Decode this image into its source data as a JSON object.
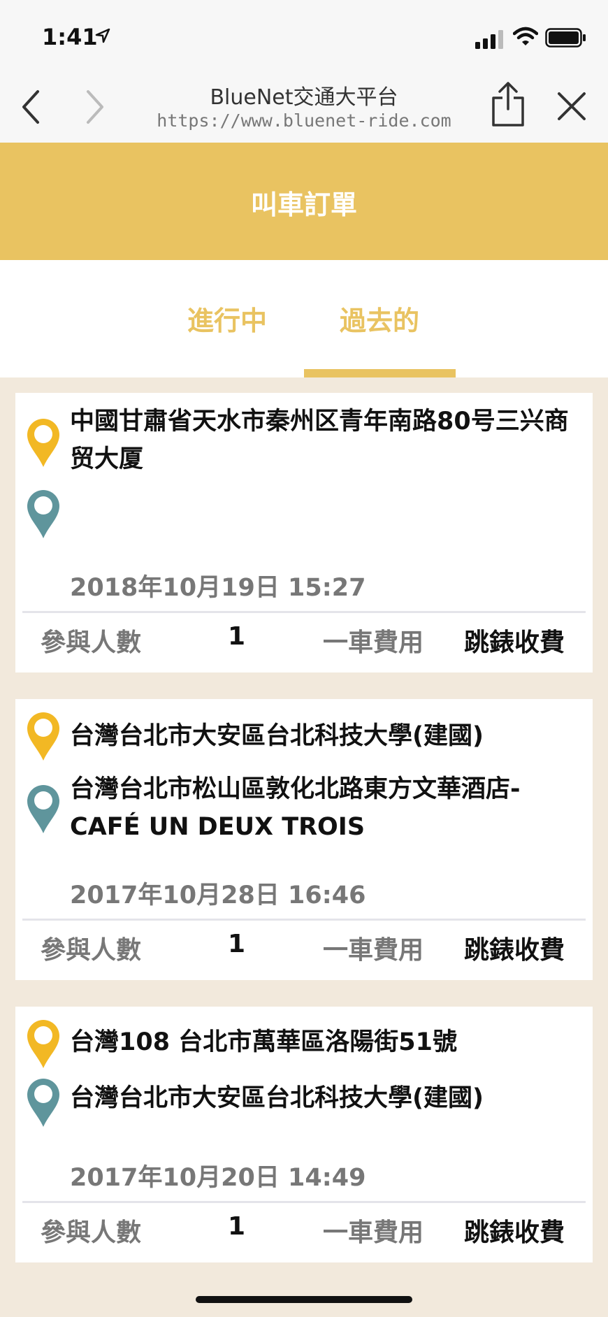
{
  "status_bar": {
    "time": "1:41"
  },
  "browser": {
    "title": "BlueNet交通大平台",
    "url": "https://www.bluenet-ride.com"
  },
  "page": {
    "title": "叫車訂單"
  },
  "tabs": [
    {
      "label": "進行中",
      "active": false
    },
    {
      "label": "過去的",
      "active": true
    }
  ],
  "orders": [
    {
      "from": "中國甘肅省天水市秦州区青年南路80号三兴商贸大厦",
      "to": "",
      "datetime": "2018年10月19日   15:27",
      "people_label": "參與人數",
      "people": "1",
      "fee_label": "一車費用",
      "fee": "跳錶收費"
    },
    {
      "from": "台灣台北市大安區台北科技大學(建國)",
      "to": "台灣台北市松山區敦化北路東方文華酒店- CAFÉ UN DEUX TROIS",
      "datetime": "2017年10月28日   16:46",
      "people_label": "參與人數",
      "people": "1",
      "fee_label": "一車費用",
      "fee": "跳錶收費"
    },
    {
      "from": "台灣108 台北市萬華區洛陽街51號",
      "to": "台灣台北市大安區台北科技大學(建國)",
      "datetime": "2017年10月20日   14:49",
      "people_label": "參與人數",
      "people": "1",
      "fee_label": "一車費用",
      "fee": "跳錶收費"
    }
  ],
  "colors": {
    "accent": "#e9c361",
    "background": "#f2e9dc",
    "origin_pin": "#f2b824",
    "destination_pin": "#5f959c"
  }
}
